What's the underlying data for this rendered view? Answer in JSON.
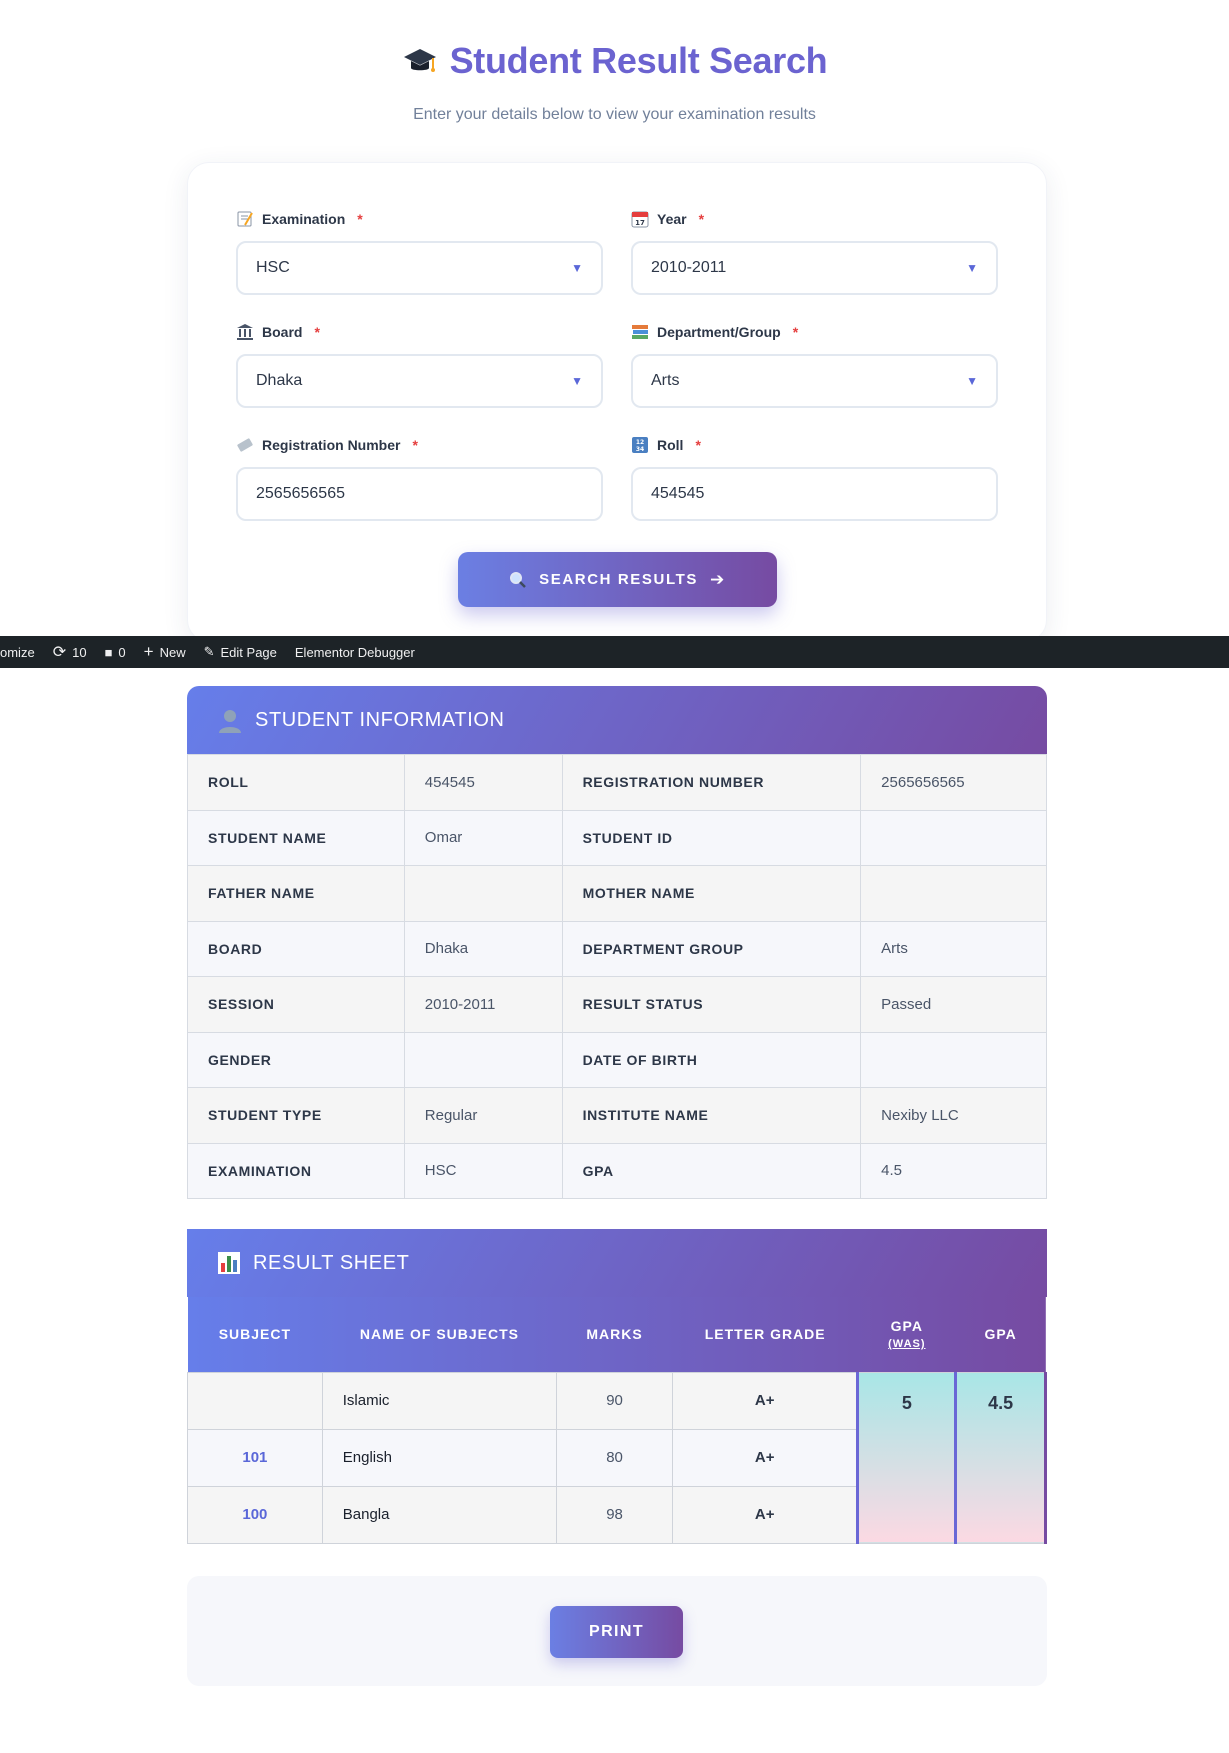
{
  "header": {
    "title": "Student Result Search",
    "subtitle": "Enter your details below to view your examination results"
  },
  "form": {
    "examination": {
      "label": "Examination",
      "value": "HSC"
    },
    "year": {
      "label": "Year",
      "value": "2010-2011"
    },
    "board": {
      "label": "Board",
      "value": "Dhaka"
    },
    "department": {
      "label": "Department/Group",
      "value": "Arts"
    },
    "registration": {
      "label": "Registration Number",
      "value": "2565656565"
    },
    "roll": {
      "label": "Roll",
      "value": "454545"
    },
    "required_mark": "*",
    "search_label": "SEARCH RESULTS"
  },
  "adminbar": {
    "customize": "omize",
    "updates": "10",
    "comments": "0",
    "new": "New",
    "edit": "Edit Page",
    "debugger": "Elementor Debugger"
  },
  "student_info": {
    "title": "STUDENT INFORMATION",
    "rows": [
      [
        "ROLL",
        "454545",
        "REGISTRATION NUMBER",
        "2565656565"
      ],
      [
        "STUDENT NAME",
        "Omar",
        "STUDENT ID",
        ""
      ],
      [
        "FATHER NAME",
        "",
        "MOTHER NAME",
        ""
      ],
      [
        "BOARD",
        "Dhaka",
        "DEPARTMENT GROUP",
        "Arts"
      ],
      [
        "SESSION",
        "2010-2011",
        "RESULT STATUS",
        "Passed"
      ],
      [
        "GENDER",
        "",
        "DATE OF BIRTH",
        ""
      ],
      [
        "STUDENT TYPE",
        "Regular",
        "INSTITUTE NAME",
        "Nexiby LLC"
      ],
      [
        "EXAMINATION",
        "HSC",
        "GPA",
        "4.5"
      ]
    ]
  },
  "result_sheet": {
    "title": "RESULT SHEET",
    "headers": {
      "subject": "SUBJECT",
      "name": "NAME OF SUBJECTS",
      "marks": "MARKS",
      "grade": "LETTER GRADE",
      "gpa_was": "GPA",
      "gpa_was_sub": "(WAS)",
      "gpa": "GPA"
    },
    "rows": [
      {
        "code": "",
        "name": "Islamic",
        "marks": "90",
        "grade": "A+"
      },
      {
        "code": "101",
        "name": "English",
        "marks": "80",
        "grade": "A+"
      },
      {
        "code": "100",
        "name": "Bangla",
        "marks": "98",
        "grade": "A+"
      }
    ],
    "gpa_was_value": "5",
    "gpa_value": "4.5"
  },
  "print_label": "PRINT",
  "colors": {
    "accent": "#667eea",
    "accent_end": "#764ba2",
    "title": "#6b63d0",
    "required": "#e53e3e"
  }
}
